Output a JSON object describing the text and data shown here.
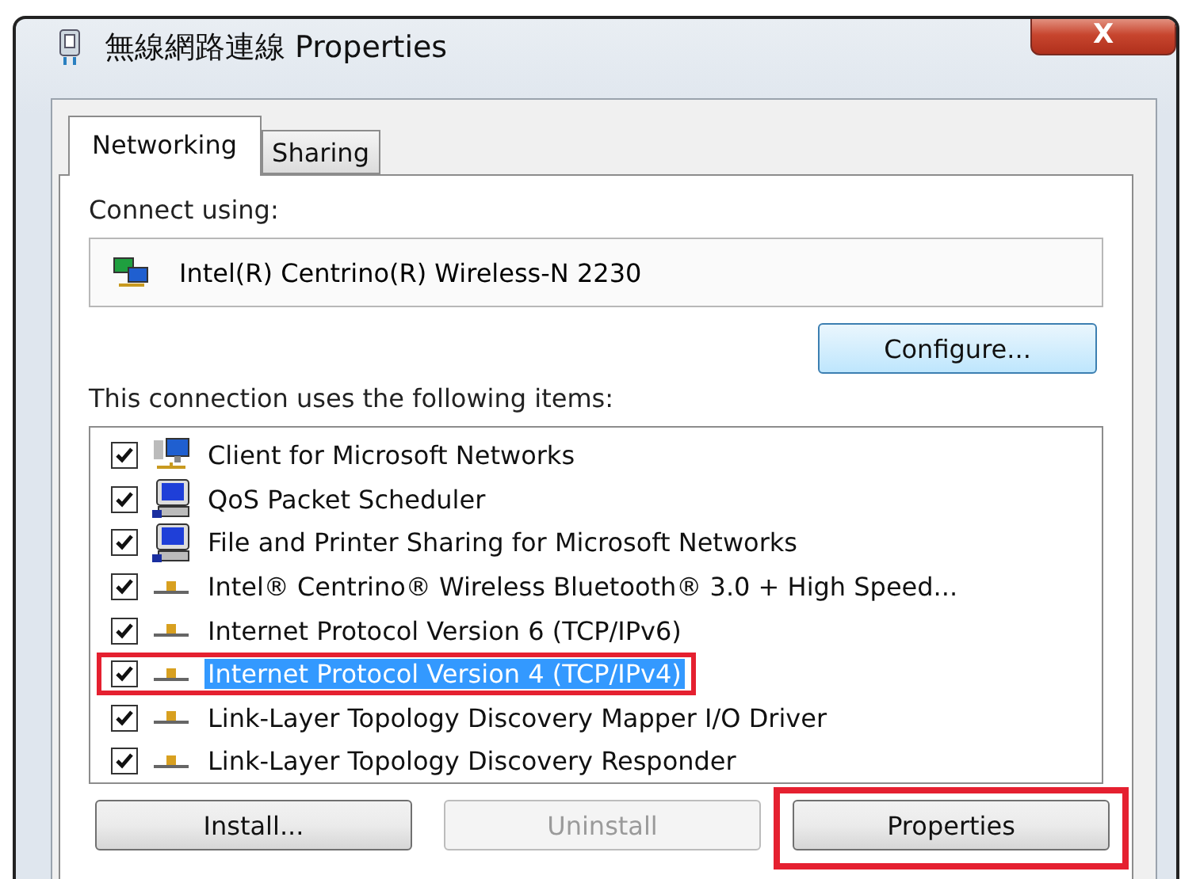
{
  "window": {
    "title": "無線網路連線 Properties",
    "close": "X"
  },
  "tabs": [
    {
      "label": "Networking",
      "selected": true
    },
    {
      "label": "Sharing",
      "selected": false
    }
  ],
  "connect_using": {
    "label": "Connect using:",
    "adapter": "Intel(R) Centrino(R) Wireless-N 2230",
    "configure": "Configure..."
  },
  "items_label": "This connection uses the following items:",
  "items": [
    {
      "kind": "client",
      "label": "Client for Microsoft Networks",
      "checked": true,
      "selected": false,
      "highlighted": false
    },
    {
      "kind": "service",
      "label": "QoS Packet Scheduler",
      "checked": true,
      "selected": false,
      "highlighted": false
    },
    {
      "kind": "service",
      "label": "File and Printer Sharing for Microsoft Networks",
      "checked": true,
      "selected": false,
      "highlighted": false
    },
    {
      "kind": "protocol",
      "label": "Intel® Centrino® Wireless Bluetooth® 3.0 + High Speed...",
      "checked": true,
      "selected": false,
      "highlighted": false
    },
    {
      "kind": "protocol",
      "label": "Internet Protocol Version 6 (TCP/IPv6)",
      "checked": true,
      "selected": false,
      "highlighted": false
    },
    {
      "kind": "protocol",
      "label": "Internet Protocol Version 4 (TCP/IPv4)",
      "checked": true,
      "selected": true,
      "highlighted": true
    },
    {
      "kind": "protocol",
      "label": "Link-Layer Topology Discovery Mapper I/O Driver",
      "checked": true,
      "selected": false,
      "highlighted": false
    },
    {
      "kind": "protocol",
      "label": "Link-Layer Topology Discovery Responder",
      "checked": true,
      "selected": false,
      "highlighted": false
    }
  ],
  "buttons": [
    {
      "label": "Install...",
      "disabled": false,
      "highlighted": false
    },
    {
      "label": "Uninstall",
      "disabled": true,
      "highlighted": false
    },
    {
      "label": "Properties",
      "disabled": false,
      "highlighted": true
    }
  ]
}
